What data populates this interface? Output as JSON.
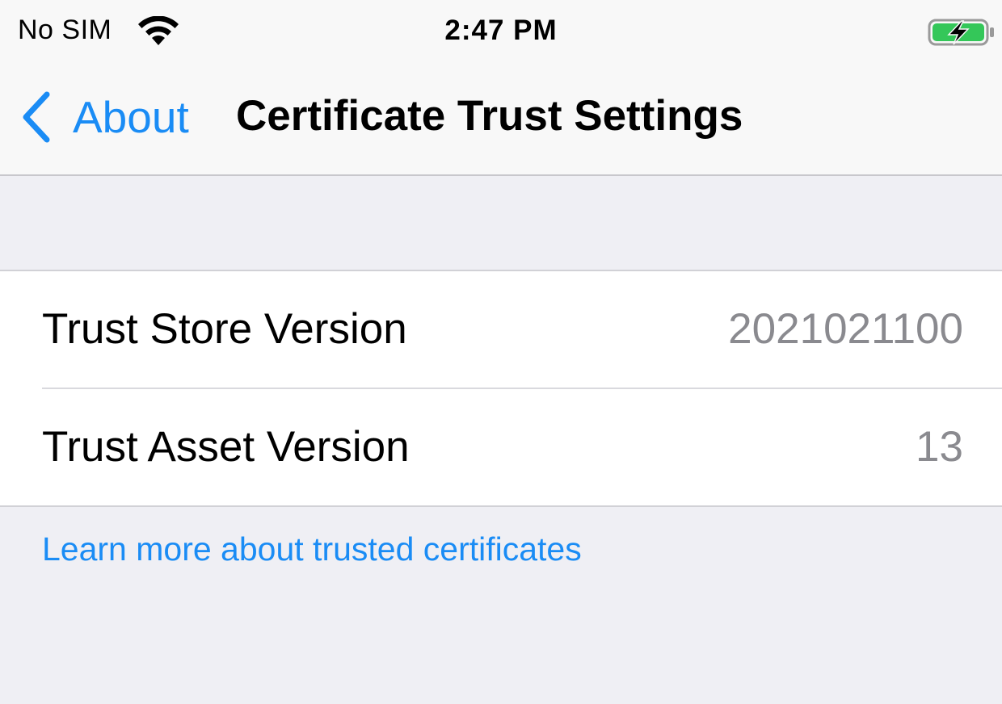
{
  "status_bar": {
    "carrier": "No SIM",
    "time": "2:47 PM",
    "wifi_icon": "wifi-icon",
    "battery_icon": "battery-charging-icon",
    "battery_color": "#34c759"
  },
  "nav_bar": {
    "back_label": "About",
    "title": "Certificate Trust Settings",
    "back_icon": "chevron-left-icon",
    "accent_color": "#1a8cf5"
  },
  "rows": [
    {
      "label": "Trust Store Version",
      "value": "2021021100"
    },
    {
      "label": "Trust Asset Version",
      "value": "13"
    }
  ],
  "footer": {
    "link_text": "Learn more about trusted certificates"
  }
}
